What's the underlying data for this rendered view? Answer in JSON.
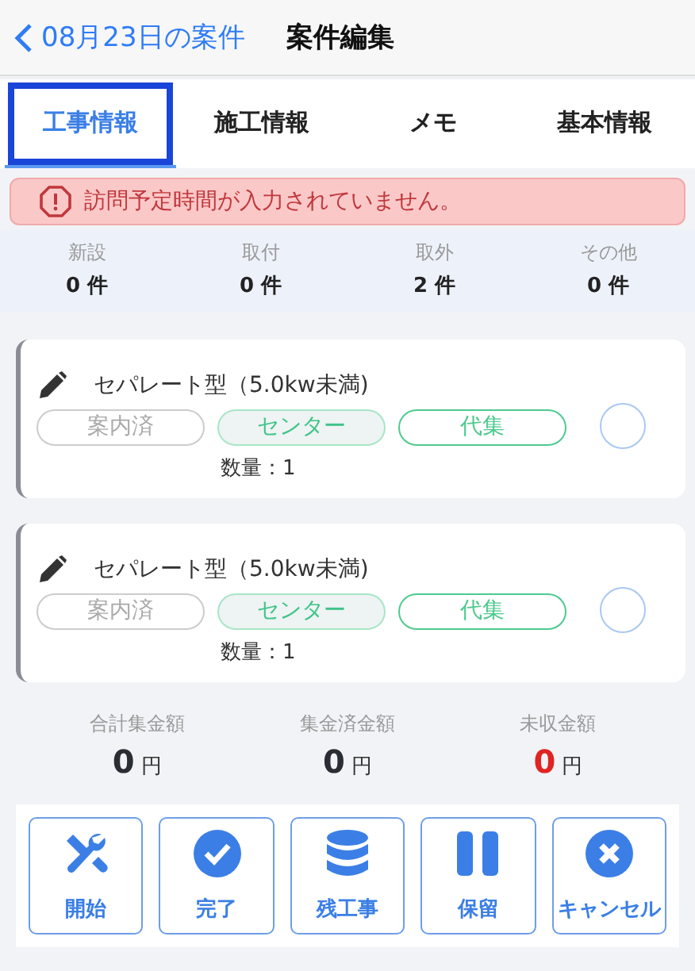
{
  "header": {
    "back_label": "08月23日の案件",
    "title": "案件編集"
  },
  "tabs": [
    {
      "label": "工事情報",
      "selected": true
    },
    {
      "label": "施工情報",
      "selected": false
    },
    {
      "label": "メモ",
      "selected": false
    },
    {
      "label": "基本情報",
      "selected": false
    }
  ],
  "alert": {
    "message": "訪問予定時間が入力されていません。"
  },
  "counts": [
    {
      "label": "新設",
      "value": "0 件"
    },
    {
      "label": "取付",
      "value": "0 件"
    },
    {
      "label": "取外",
      "value": "2 件"
    },
    {
      "label": "その他",
      "value": "0 件"
    }
  ],
  "items": [
    {
      "name": "セパレート型（5.0kw未満)",
      "tags": [
        {
          "label": "案内済",
          "kind": "muted"
        },
        {
          "label": "センター",
          "kind": "soft"
        },
        {
          "label": "代集",
          "kind": "outline"
        }
      ],
      "quantity": "数量：1",
      "checked": false
    },
    {
      "name": "セパレート型（5.0kw未満)",
      "tags": [
        {
          "label": "案内済",
          "kind": "muted"
        },
        {
          "label": "センター",
          "kind": "soft"
        },
        {
          "label": "代集",
          "kind": "outline"
        }
      ],
      "quantity": "数量：1",
      "checked": false
    }
  ],
  "totals": [
    {
      "label": "合計集金額",
      "amount": "0",
      "unit": "円",
      "alert": false
    },
    {
      "label": "集金済金額",
      "amount": "0",
      "unit": "円",
      "alert": false
    },
    {
      "label": "未収金額",
      "amount": "0",
      "unit": "円",
      "alert": true
    }
  ],
  "actions": [
    {
      "label": "開始",
      "kind": "tools"
    },
    {
      "label": "完了",
      "kind": "check"
    },
    {
      "label": "残工事",
      "kind": "database"
    },
    {
      "label": "保留",
      "kind": "pause"
    },
    {
      "label": "キャンセル",
      "kind": "cancel"
    }
  ]
}
